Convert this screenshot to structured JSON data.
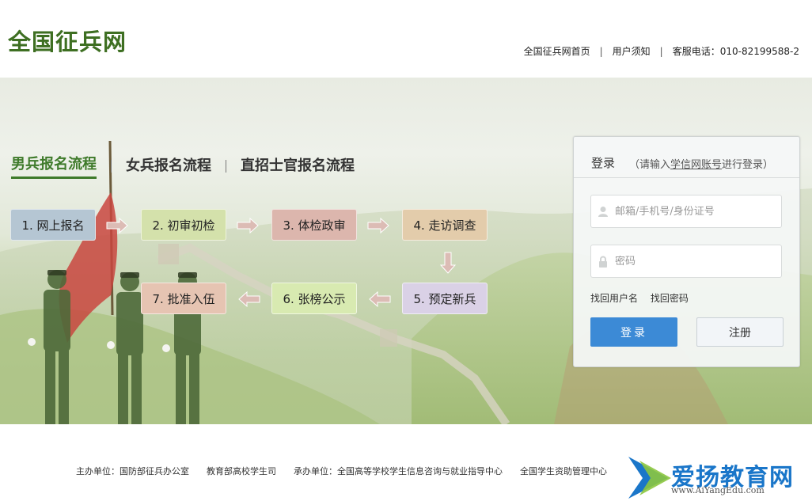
{
  "header": {
    "logo": "全国征兵网",
    "nav": [
      {
        "label": "全国征兵网首页"
      },
      {
        "label": "用户须知"
      },
      {
        "label": "客服电话：010-82199588-2"
      }
    ],
    "separator": "|"
  },
  "tabs": [
    {
      "label": "男兵报名流程",
      "active": true
    },
    {
      "label": "女兵报名流程",
      "active": false
    },
    {
      "label": "直招士官报名流程",
      "active": false
    }
  ],
  "steps": [
    {
      "label": "1. 网上报名",
      "color": "#b5c6d3"
    },
    {
      "label": "2. 初审初检",
      "color": "#d4e1ab"
    },
    {
      "label": "3. 体检政审",
      "color": "#dcb6ad"
    },
    {
      "label": "4. 走访调查",
      "color": "#e3ccab"
    },
    {
      "label": "5. 预定新兵",
      "color": "#dad1e6"
    },
    {
      "label": "6. 张榜公示",
      "color": "#d8eab1"
    },
    {
      "label": "7. 批准入伍",
      "color": "#e6c4b2"
    }
  ],
  "login": {
    "title": "登录",
    "hint_prefix": "（请输入",
    "hint_link": "学信网账号",
    "hint_suffix": "进行登录）",
    "username_placeholder": "邮箱/手机号/身份证号",
    "password_placeholder": "密码",
    "find_username": "找回用户名",
    "find_password": "找回密码",
    "login_button": "登录",
    "register_button": "注册"
  },
  "footer": {
    "host": "主办单位：国防部征兵办公室",
    "host2": "教育部高校学生司",
    "organizer": "承办单位：全国高等学校学生信息咨询与就业指导中心",
    "organizer2": "全国学生资助管理中心"
  },
  "watermark": {
    "text": "爱扬教育网",
    "url": "www.AiYangEdu.com"
  },
  "colors": {
    "brand_green": "#3e7a2a",
    "login_blue": "#3c8ad6",
    "arrow": "#d9b0ad"
  }
}
